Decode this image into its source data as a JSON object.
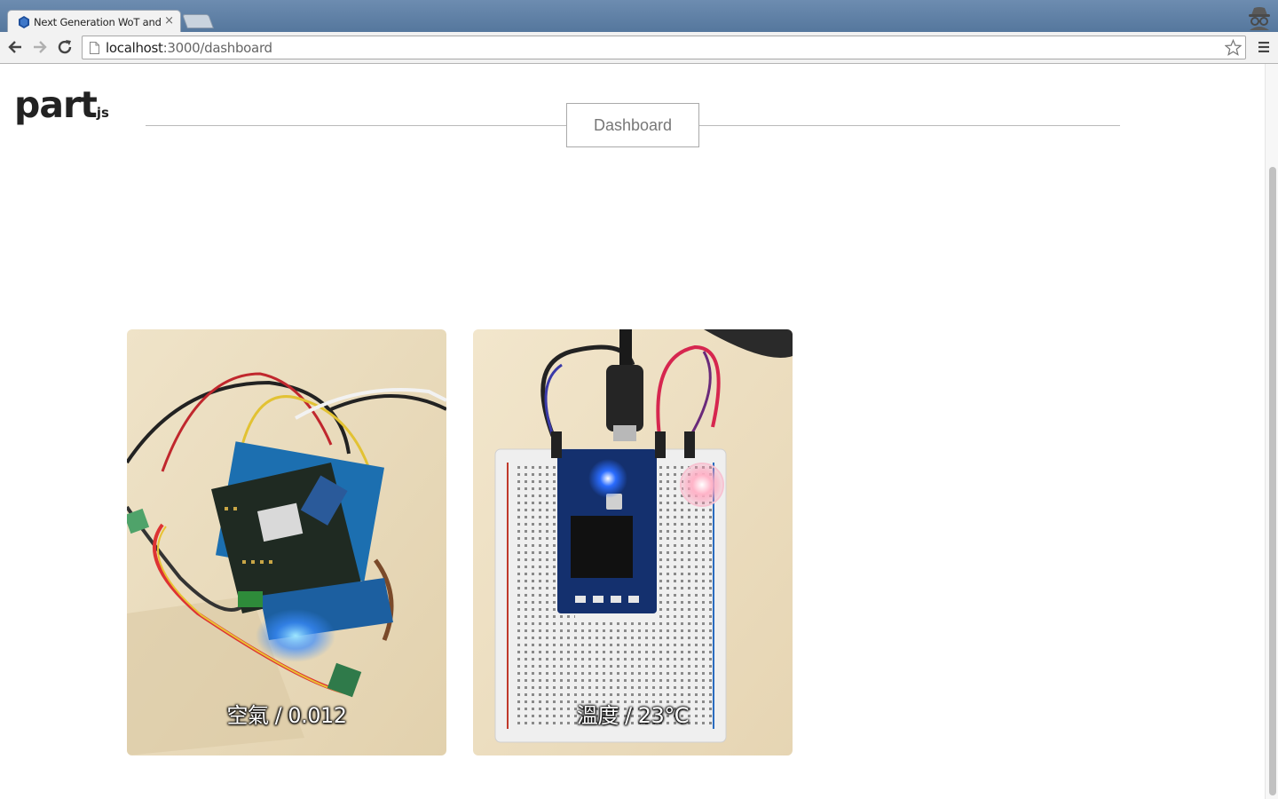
{
  "browser": {
    "tab_title": "Next Generation WoT and",
    "tab_close": "×",
    "url_host": "localhost",
    "url_path": ":3000/dashboard"
  },
  "page": {
    "logo_main": "part",
    "logo_sub": "js",
    "nav_button": "Dashboard"
  },
  "cards": [
    {
      "label": "空氣 / 0.012"
    },
    {
      "label": "溫度 / 23°C"
    }
  ],
  "colors": {
    "titlebar": "#5f82a8",
    "card_background": "#e9d9bd",
    "led_blue": "#2a6cff",
    "led_pink": "#ff8fb0"
  }
}
